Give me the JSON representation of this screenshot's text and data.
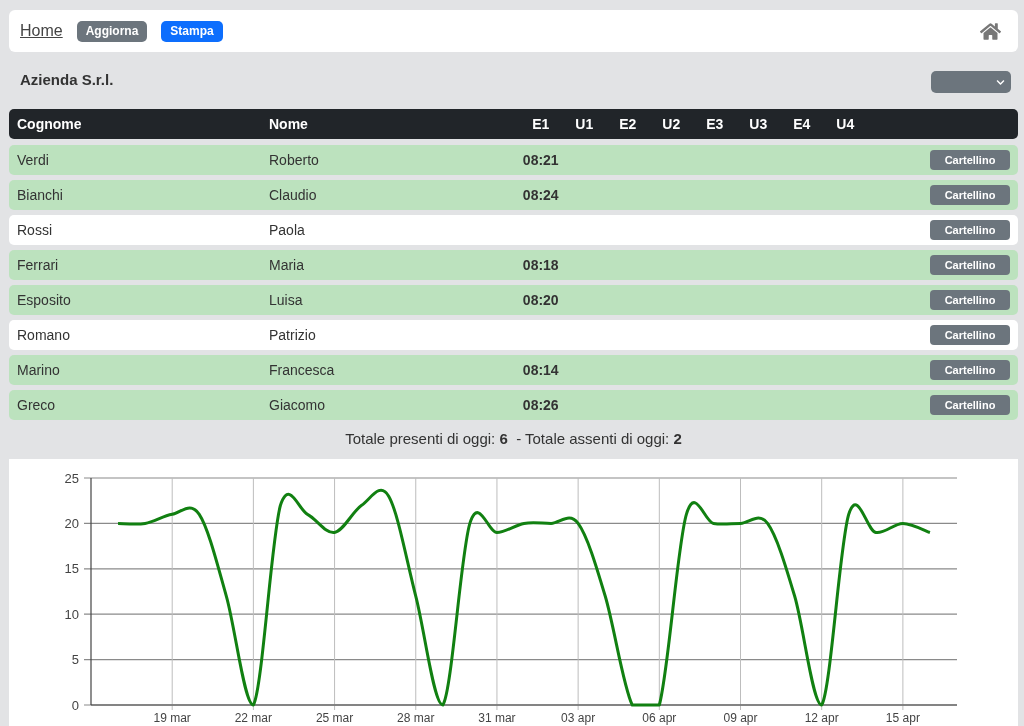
{
  "nav": {
    "items": [
      {
        "label": "Home",
        "kind": "link"
      },
      {
        "label": "Aggiorna",
        "kind": "secondary"
      },
      {
        "label": "Stampa",
        "kind": "primary"
      }
    ]
  },
  "company": "Azienda S.r.l.",
  "table": {
    "columns": [
      "Cognome",
      "Nome",
      "E1",
      "U1",
      "E2",
      "U2",
      "E3",
      "U3",
      "E4",
      "U4"
    ],
    "rows": [
      {
        "surname": "Verdi",
        "name": "Roberto",
        "present": true,
        "times": [
          "08:21"
        ],
        "button": "Cartellino"
      },
      {
        "surname": "Bianchi",
        "name": "Claudio",
        "present": true,
        "times": [
          "08:24"
        ],
        "button": "Cartellino"
      },
      {
        "surname": "Rossi",
        "name": "Paola",
        "present": false,
        "button": "Cartellino"
      },
      {
        "surname": "Ferrari",
        "name": "Maria",
        "present": true,
        "times": [
          "08:18"
        ],
        "button": "Cartellino"
      },
      {
        "surname": "Esposito",
        "name": "Luisa",
        "present": true,
        "times": [
          "08:20"
        ],
        "button": "Cartellino"
      },
      {
        "surname": "Romano",
        "name": "Patrizio",
        "present": false,
        "button": "Cartellino"
      },
      {
        "surname": "Marino",
        "name": "Francesca",
        "present": true,
        "times": [
          "08:14"
        ],
        "button": "Cartellino"
      },
      {
        "surname": "Greco",
        "name": "Giacomo",
        "present": true,
        "times": [
          "08:26"
        ],
        "button": "Cartellino"
      }
    ]
  },
  "summary": "Totale presenti di oggi: **6**  - Totale assenti di oggi: **2**",
  "chart": {
    "chart_data": {
      "type": "line",
      "categories": [
        null,
        null,
        "19 mar",
        null,
        null,
        "22 mar",
        null,
        null,
        "25 mar",
        null,
        null,
        "28 mar",
        null,
        null,
        "31 mar",
        null,
        null,
        "03 apr",
        null,
        null,
        "06 apr",
        null,
        null,
        "09 apr",
        null,
        null,
        "12 apr",
        null,
        null,
        "15 apr",
        null
      ],
      "series": [
        {
          "color": "#118011",
          "values": [
            20,
            20,
            21,
            21,
            12,
            0,
            22,
            21,
            19,
            22,
            23,
            12,
            0,
            20,
            19,
            20,
            20,
            20,
            12,
            0,
            0,
            21,
            20,
            20,
            20,
            12,
            0,
            21,
            19,
            20,
            19
          ]
        }
      ],
      "ylim": [
        0,
        25
      ],
      "yticks": [
        0,
        5,
        10,
        15,
        20,
        25
      ],
      "grid": true
    }
  }
}
